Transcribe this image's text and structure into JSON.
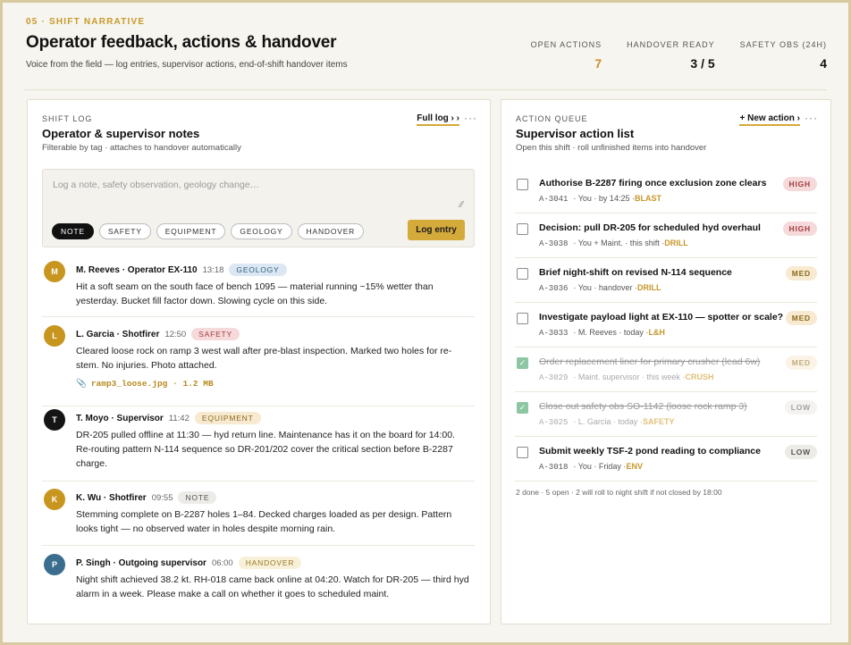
{
  "header": {
    "eyebrow": "05 · SHIFT NARRATIVE",
    "title": "Operator feedback, actions & handover",
    "subtitle": "Voice from the field — log entries, supervisor actions, end-of-shift handover items",
    "stats": [
      {
        "label": "OPEN ACTIONS",
        "value": "7"
      },
      {
        "label": "HANDOVER READY",
        "value": "3 / 5"
      },
      {
        "label": "SAFETY OBS (24H)",
        "value": "4"
      }
    ]
  },
  "shift_log": {
    "eyebrow": "SHIFT LOG",
    "title": "Operator & supervisor notes",
    "subtitle": "Filterable by tag · attaches to handover automatically",
    "link": "Full log › ›",
    "more": "···",
    "compose": {
      "placeholder": "Log a note, safety observation, geology change…",
      "tags": [
        "NOTE",
        "SAFETY",
        "EQUIPMENT",
        "GEOLOGY",
        "HANDOVER"
      ],
      "button": "Log entry"
    },
    "entries": [
      {
        "initial": "M",
        "name": "M. Reeves · Operator EX-110",
        "time": "13:18",
        "tag": "GEOLOGY",
        "body": "Hit a soft seam on the south face of bench 1095 — material running ~15% wetter than yesterday. Bucket fill factor down. Slowing cycle on this side."
      },
      {
        "initial": "L",
        "name": "L. Garcia · Shotfirer",
        "time": "12:50",
        "tag": "SAFETY",
        "body": "Cleared loose rock on ramp 3 west wall after pre-blast inspection. Marked two holes for re-stem. No injuries. Photo attached.",
        "attachment": "ramp3_loose.jpg · 1.2 MB"
      },
      {
        "initial": "T",
        "name": "T. Moyo · Supervisor",
        "time": "11:42",
        "tag": "EQUIPMENT",
        "body": "DR-205 pulled offline at 11:30 — hyd return line. Maintenance has it on the board for 14:00. Re-routing pattern N-114 sequence so DR-201/202 cover the critical section before B-2287 charge."
      },
      {
        "initial": "K",
        "name": "K. Wu · Shotfirer",
        "time": "09:55",
        "tag": "NOTE",
        "body": "Stemming complete on B-2287 holes 1–84. Decked charges loaded as per design. Pattern looks tight — no observed water in holes despite morning rain."
      },
      {
        "initial": "P",
        "name": "P. Singh · Outgoing supervisor",
        "time": "06:00",
        "tag": "HANDOVER",
        "body": "Night shift achieved 38.2 kt. RH-018 came back online at 04:20. Watch for DR-205 — third hyd alarm in a week. Please make a call on whether it goes to scheduled maint."
      }
    ]
  },
  "action_queue": {
    "eyebrow": "ACTION QUEUE",
    "title": "Supervisor action list",
    "subtitle": "Open this shift · roll unfinished items into handover",
    "link": "+ New action ›",
    "more": "···",
    "items": [
      {
        "title": "Authorise B-2287 firing once exclusion zone clears",
        "id": "A-3041",
        "meta": "· You · by 14:25 ·",
        "cat": "BLAST",
        "priority": "HIGH",
        "done": false
      },
      {
        "title": "Decision: pull DR-205 for scheduled hyd overhaul",
        "id": "A-3038",
        "meta": "· You + Maint. · this shift ·",
        "cat": "DRILL",
        "priority": "HIGH",
        "done": false
      },
      {
        "title": "Brief night-shift on revised N-114 sequence",
        "id": "A-3036",
        "meta": "· You · handover ·",
        "cat": "DRILL",
        "priority": "MED",
        "done": false
      },
      {
        "title": "Investigate payload light at EX-110 — spotter or scale?",
        "id": "A-3033",
        "meta": "· M. Reeves · today ·",
        "cat": "L&H",
        "priority": "MED",
        "done": false
      },
      {
        "title": "Order replacement liner for primary crusher (lead 6w)",
        "id": "A-3029",
        "meta": "· Maint. supervisor · this week ·",
        "cat": "CRUSH",
        "priority": "MED",
        "done": true
      },
      {
        "title": "Close out safety obs SO-1142 (loose rock ramp 3)",
        "id": "A-3025",
        "meta": "· L. Garcia · today ·",
        "cat": "SAFETY",
        "priority": "LOW",
        "done": true
      },
      {
        "title": "Submit weekly TSF-2 pond reading to compliance",
        "id": "A-3018",
        "meta": "· You · Friday ·",
        "cat": "ENV",
        "priority": "LOW",
        "done": false
      }
    ],
    "footnote": "2 done · 5 open · 2 will roll to night shift if not closed by 18:00"
  },
  "colors": {
    "accent": "#d4aa3b",
    "avatar_gold": "#c8961f",
    "avatar_dark": "#151515",
    "avatar_blue": "#3b6d8f",
    "tag_geology": "#dbe8f3",
    "tag_safety": "#f6dadb",
    "tag_equipment": "#f8ead0",
    "tag_note": "#ecebe8",
    "tag_handover": "#f8f0d9"
  }
}
